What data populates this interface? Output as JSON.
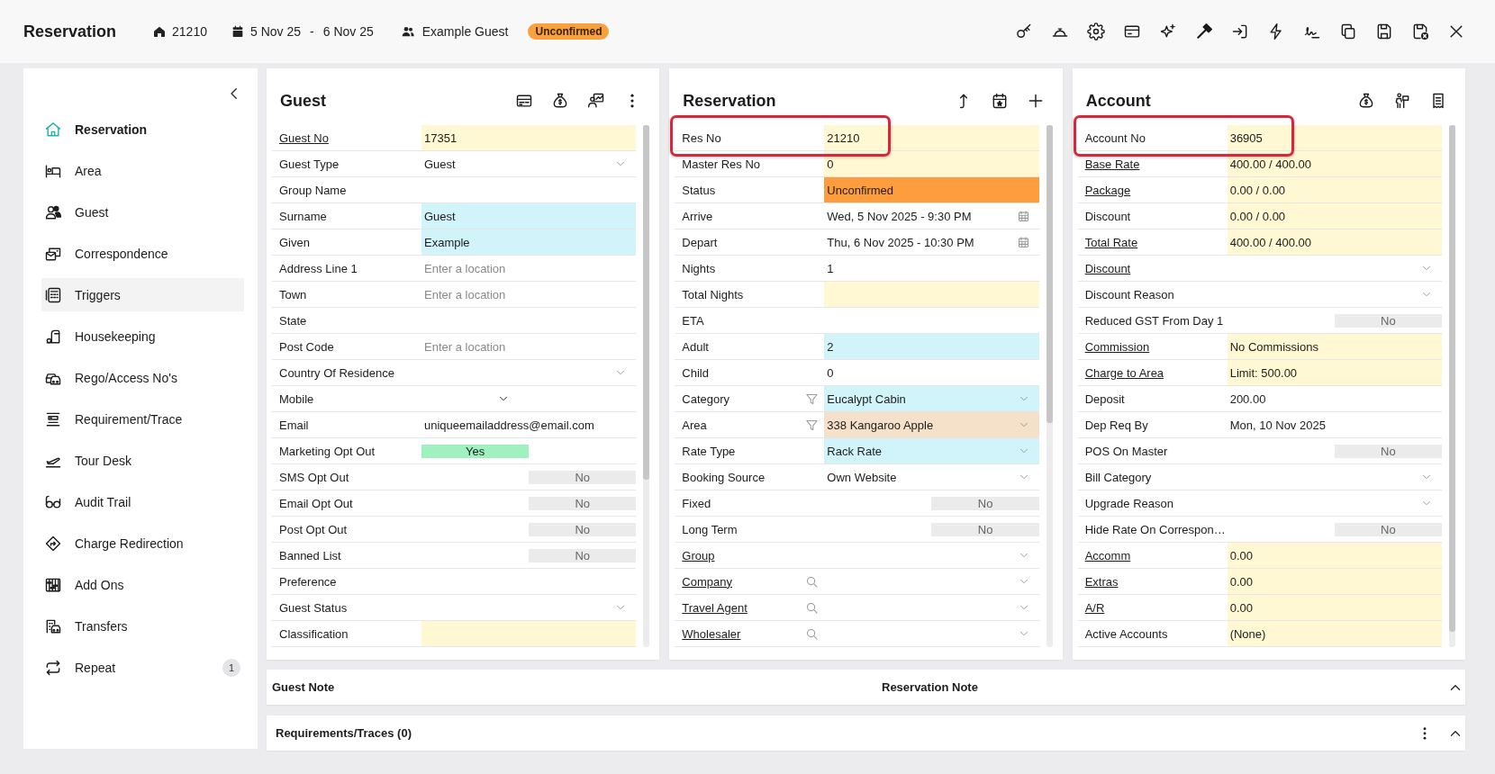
{
  "header": {
    "title": "Reservation",
    "reservation_no": "21210",
    "arrive": "5 Nov 25",
    "date_separator": "-",
    "depart": "6 Nov 25",
    "guest": "Example Guest",
    "status": "Unconfirmed"
  },
  "sidebar": {
    "items": [
      {
        "label": "Reservation",
        "selected": true,
        "hovered": false
      },
      {
        "label": "Area",
        "selected": false,
        "hovered": false
      },
      {
        "label": "Guest",
        "selected": false,
        "hovered": false
      },
      {
        "label": "Correspondence",
        "selected": false,
        "hovered": false
      },
      {
        "label": "Triggers",
        "selected": false,
        "hovered": true
      },
      {
        "label": "Housekeeping",
        "selected": false,
        "hovered": false
      },
      {
        "label": "Rego/Access No's",
        "selected": false,
        "hovered": false
      },
      {
        "label": "Requirement/Trace",
        "selected": false,
        "hovered": false
      },
      {
        "label": "Tour Desk",
        "selected": false,
        "hovered": false
      },
      {
        "label": "Audit Trail",
        "selected": false,
        "hovered": false
      },
      {
        "label": "Charge Redirection",
        "selected": false,
        "hovered": false
      },
      {
        "label": "Add Ons",
        "selected": false,
        "hovered": false
      },
      {
        "label": "Transfers",
        "selected": false,
        "hovered": false
      },
      {
        "label": "Repeat",
        "selected": false,
        "hovered": false,
        "count": "1"
      }
    ]
  },
  "panels": [
    {
      "title": "Guest",
      "rows": [
        {
          "label": "Guest No",
          "kind": "text",
          "link": true,
          "highlighted": false,
          "value": "17351",
          "color": "#fff8d2"
        },
        {
          "label": "Guest Type",
          "kind": "select",
          "link": false,
          "highlighted": false,
          "value": "Guest"
        },
        {
          "label": "Group Name",
          "kind": "text",
          "link": false,
          "highlighted": false
        },
        {
          "label": "Surname",
          "kind": "text",
          "link": false,
          "highlighted": false,
          "value": "Guest",
          "color": "#d1f4fa"
        },
        {
          "label": "Given",
          "kind": "text",
          "link": false,
          "highlighted": false,
          "value": "Example",
          "color": "#d1f4fa"
        },
        {
          "label": "Address Line 1",
          "kind": "text",
          "link": false,
          "highlighted": false,
          "placeholder": "Enter a location"
        },
        {
          "label": "Town",
          "kind": "text",
          "link": false,
          "highlighted": false,
          "placeholder": "Enter a location"
        },
        {
          "label": "State",
          "kind": "text",
          "link": false,
          "highlighted": false
        },
        {
          "label": "Post Code",
          "kind": "text",
          "link": false,
          "highlighted": false,
          "placeholder": "Enter a location"
        },
        {
          "label": "Country Of Residence",
          "kind": "select",
          "link": false,
          "highlighted": false
        },
        {
          "label": "Mobile",
          "kind": "phone",
          "link": false,
          "highlighted": false
        },
        {
          "label": "Email",
          "kind": "text",
          "link": false,
          "highlighted": false,
          "value": "uniqueemailaddress@email.com"
        },
        {
          "label": "Marketing Opt Out",
          "kind": "toggle",
          "link": false,
          "highlighted": false,
          "value": "Yes",
          "on": true
        },
        {
          "label": "SMS Opt Out",
          "kind": "toggle",
          "link": false,
          "highlighted": false,
          "value": "No",
          "on": false
        },
        {
          "label": "Email Opt Out",
          "kind": "toggle",
          "link": false,
          "highlighted": false,
          "value": "No",
          "on": false
        },
        {
          "label": "Post Opt Out",
          "kind": "toggle",
          "link": false,
          "highlighted": false,
          "value": "No",
          "on": false
        },
        {
          "label": "Banned List",
          "kind": "toggle",
          "link": false,
          "highlighted": false,
          "value": "No",
          "on": false
        },
        {
          "label": "Preference",
          "kind": "text",
          "link": false,
          "highlighted": false
        },
        {
          "label": "Guest Status",
          "kind": "select",
          "link": false,
          "highlighted": false
        },
        {
          "label": "Classification",
          "kind": "text",
          "link": false,
          "highlighted": false,
          "color": "#fff8d2"
        }
      ]
    },
    {
      "title": "Reservation",
      "rows": [
        {
          "label": "Res No",
          "kind": "text",
          "link": false,
          "highlighted": true,
          "value": "21210",
          "color": "#fff8d2"
        },
        {
          "label": "Master Res No",
          "kind": "text",
          "link": false,
          "highlighted": false,
          "value": "0",
          "color": "#fff8d2"
        },
        {
          "label": "Status",
          "kind": "text",
          "link": false,
          "highlighted": false,
          "value": "Unconfirmed",
          "color": "#fd9d3d"
        },
        {
          "label": "Arrive",
          "kind": "date",
          "link": false,
          "highlighted": false,
          "value": "Wed, 5 Nov 2025 - 9:30 PM"
        },
        {
          "label": "Depart",
          "kind": "date",
          "link": false,
          "highlighted": false,
          "value": "Thu, 6 Nov 2025 - 10:30 PM"
        },
        {
          "label": "Nights",
          "kind": "text",
          "link": false,
          "highlighted": false,
          "value": "1"
        },
        {
          "label": "Total Nights",
          "kind": "text",
          "link": false,
          "highlighted": false,
          "color": "#fff8d2"
        },
        {
          "label": "ETA",
          "kind": "text",
          "link": false,
          "highlighted": false
        },
        {
          "label": "Adult",
          "kind": "text",
          "link": false,
          "highlighted": false,
          "value": "2",
          "color": "#d1f4fa"
        },
        {
          "label": "Child",
          "kind": "text",
          "link": false,
          "highlighted": false,
          "value": "0"
        },
        {
          "label": "Category",
          "kind": "filter-select",
          "link": false,
          "highlighted": false,
          "value": "Eucalypt Cabin",
          "color": "#d1f4fa"
        },
        {
          "label": "Area",
          "kind": "filter-select",
          "link": false,
          "highlighted": false,
          "value": "338 Kangaroo Apple",
          "color": "#f5e1c9"
        },
        {
          "label": "Rate Type",
          "kind": "select",
          "link": false,
          "highlighted": false,
          "value": "Rack Rate",
          "color": "#d1f4fa"
        },
        {
          "label": "Booking Source",
          "kind": "select",
          "link": false,
          "highlighted": false,
          "value": "Own Website"
        },
        {
          "label": "Fixed",
          "kind": "toggle",
          "link": false,
          "highlighted": false,
          "value": "No",
          "on": false
        },
        {
          "label": "Long Term",
          "kind": "toggle",
          "link": false,
          "highlighted": false,
          "value": "No",
          "on": false
        },
        {
          "label": "Group",
          "kind": "select",
          "link": true,
          "highlighted": false
        },
        {
          "label": "Company",
          "kind": "search-select",
          "link": true,
          "highlighted": false
        },
        {
          "label": "Travel Agent",
          "kind": "search-select",
          "link": true,
          "highlighted": false
        },
        {
          "label": "Wholesaler",
          "kind": "search-select",
          "link": true,
          "highlighted": false
        }
      ]
    },
    {
      "title": "Account",
      "rows": [
        {
          "label": "Account No",
          "kind": "text",
          "link": false,
          "highlighted": true,
          "value": "36905",
          "color": "#fff8d2"
        },
        {
          "label": "Base Rate",
          "kind": "text",
          "link": true,
          "highlighted": false,
          "value": "400.00 / 400.00",
          "color": "#fff8d2"
        },
        {
          "label": "Package",
          "kind": "text",
          "link": true,
          "highlighted": false,
          "value": "0.00 / 0.00",
          "color": "#fff8d2"
        },
        {
          "label": "Discount",
          "kind": "text",
          "link": false,
          "highlighted": false,
          "value": "0.00 / 0.00",
          "color": "#fff8d2"
        },
        {
          "label": "Total Rate",
          "kind": "text",
          "link": true,
          "highlighted": false,
          "value": "400.00 / 400.00",
          "color": "#fff8d2"
        },
        {
          "label": "Discount",
          "kind": "select",
          "link": true,
          "highlighted": false
        },
        {
          "label": "Discount Reason",
          "kind": "select",
          "link": false,
          "highlighted": false
        },
        {
          "label": "Reduced GST From Day 1",
          "kind": "toggle",
          "link": false,
          "highlighted": false,
          "value": "No",
          "on": false
        },
        {
          "label": "Commission",
          "kind": "text",
          "link": true,
          "highlighted": false,
          "value": "No Commissions",
          "color": "#fff8d2"
        },
        {
          "label": "Charge to Area",
          "kind": "text",
          "link": true,
          "highlighted": false,
          "value": "Limit: 500.00",
          "color": "#fff8d2"
        },
        {
          "label": "Deposit",
          "kind": "text",
          "link": false,
          "highlighted": false,
          "value": "200.00"
        },
        {
          "label": "Dep Req By",
          "kind": "text",
          "link": false,
          "highlighted": false,
          "value": "Mon, 10 Nov 2025"
        },
        {
          "label": "POS On Master",
          "kind": "toggle",
          "link": false,
          "highlighted": false,
          "value": "No",
          "on": false
        },
        {
          "label": "Bill Category",
          "kind": "select",
          "link": false,
          "highlighted": false
        },
        {
          "label": "Upgrade Reason",
          "kind": "select",
          "link": false,
          "highlighted": false
        },
        {
          "label": "Hide Rate On Correspon…",
          "kind": "toggle",
          "link": false,
          "highlighted": false,
          "value": "No",
          "on": false
        },
        {
          "label": "Accomm",
          "kind": "text",
          "link": true,
          "highlighted": false,
          "value": "0.00",
          "color": "#fff8d2"
        },
        {
          "label": "Extras",
          "kind": "text",
          "link": true,
          "highlighted": false,
          "value": "0.00",
          "color": "#fff8d2"
        },
        {
          "label": "A/R",
          "kind": "text",
          "link": true,
          "highlighted": false,
          "value": "0.00",
          "color": "#fff8d2"
        },
        {
          "label": "Active Accounts",
          "kind": "text",
          "link": false,
          "highlighted": false,
          "value": "(None)",
          "color": "#fff8d2"
        }
      ]
    }
  ],
  "notes_bar": {
    "guest_note": "Guest Note",
    "reservation_note": "Reservation Note"
  },
  "requirements_bar": {
    "title": "Requirements/Traces (0)"
  }
}
